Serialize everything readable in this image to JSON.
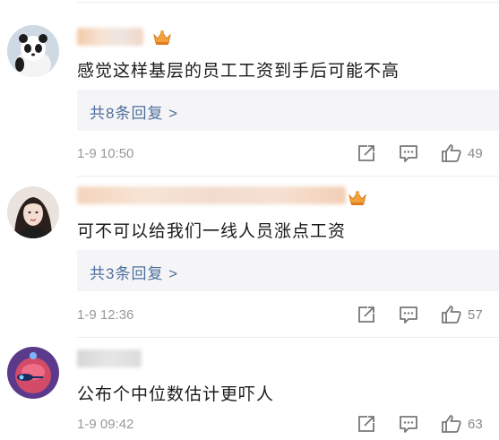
{
  "comments": [
    {
      "text": "感觉这样基层的员工工资到手后可能不高",
      "reply_label": "共8条回复 >",
      "time": "1-9 10:50",
      "likes": "49",
      "has_crown": true
    },
    {
      "text": "可不可以给我们一线人员涨点工资",
      "reply_label": "共3条回复 >",
      "time": "1-9 12:36",
      "likes": "57",
      "has_crown": true
    },
    {
      "text": "公布个中位数估计更吓人",
      "time": "1-9 09:42",
      "likes": "63",
      "has_crown": false
    }
  ],
  "icons": {
    "share": "share-icon",
    "comment": "comment-icon",
    "like": "thumbs-up-icon",
    "crown": "crown-badge-icon"
  },
  "colors": {
    "reply_link": "#4f6f9c",
    "meta_gray": "#999999",
    "crown_gold": "#f2a23a"
  }
}
